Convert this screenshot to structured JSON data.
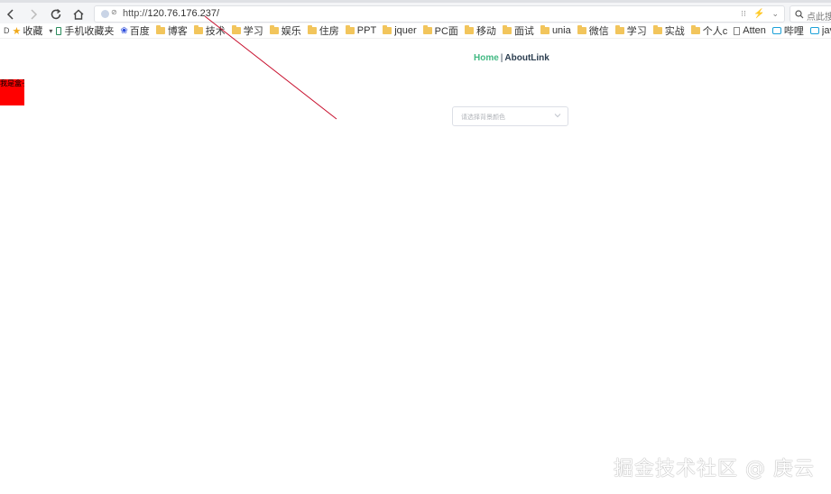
{
  "browser": {
    "url_protocol": "http://",
    "url_host": "120.76.176.237/",
    "site_badge": "⊘",
    "search_placeholder": "点此搜"
  },
  "bookmarks": {
    "leading_label": "D",
    "items": [
      {
        "label": "收藏",
        "icon": "star-icon"
      },
      {
        "label": "手机收藏夹",
        "icon": "phone-icon"
      },
      {
        "label": "百度",
        "icon": "baidu-icon"
      },
      {
        "label": "博客",
        "icon": "folder-icon"
      },
      {
        "label": "技术",
        "icon": "folder-icon"
      },
      {
        "label": "学习",
        "icon": "folder-icon"
      },
      {
        "label": "娱乐",
        "icon": "folder-icon"
      },
      {
        "label": "住房",
        "icon": "folder-icon"
      },
      {
        "label": "PPT",
        "icon": "folder-icon"
      },
      {
        "label": "jquer",
        "icon": "folder-icon"
      },
      {
        "label": "PC面",
        "icon": "folder-icon"
      },
      {
        "label": "移动",
        "icon": "folder-icon"
      },
      {
        "label": "面试",
        "icon": "folder-icon"
      },
      {
        "label": "unia",
        "icon": "folder-icon"
      },
      {
        "label": "微信",
        "icon": "folder-icon"
      },
      {
        "label": "学习",
        "icon": "folder-icon"
      },
      {
        "label": "实战",
        "icon": "folder-icon"
      },
      {
        "label": "个人c",
        "icon": "folder-icon"
      },
      {
        "label": "Atten",
        "icon": "page-icon"
      },
      {
        "label": "哔哩",
        "icon": "bili-icon"
      },
      {
        "label": "java",
        "icon": "bili-icon"
      }
    ]
  },
  "page": {
    "red_box_text": "我是盒子",
    "nav_home": "Home",
    "nav_separator": "|",
    "nav_about": "AboutLink",
    "select_placeholder": "请选择背景颜色"
  },
  "watermark": "掘金技术社区 @ 庚云",
  "colors": {
    "accent_green": "#42b983",
    "box_red": "#ff0000",
    "annotation_line": "#c8102e"
  }
}
